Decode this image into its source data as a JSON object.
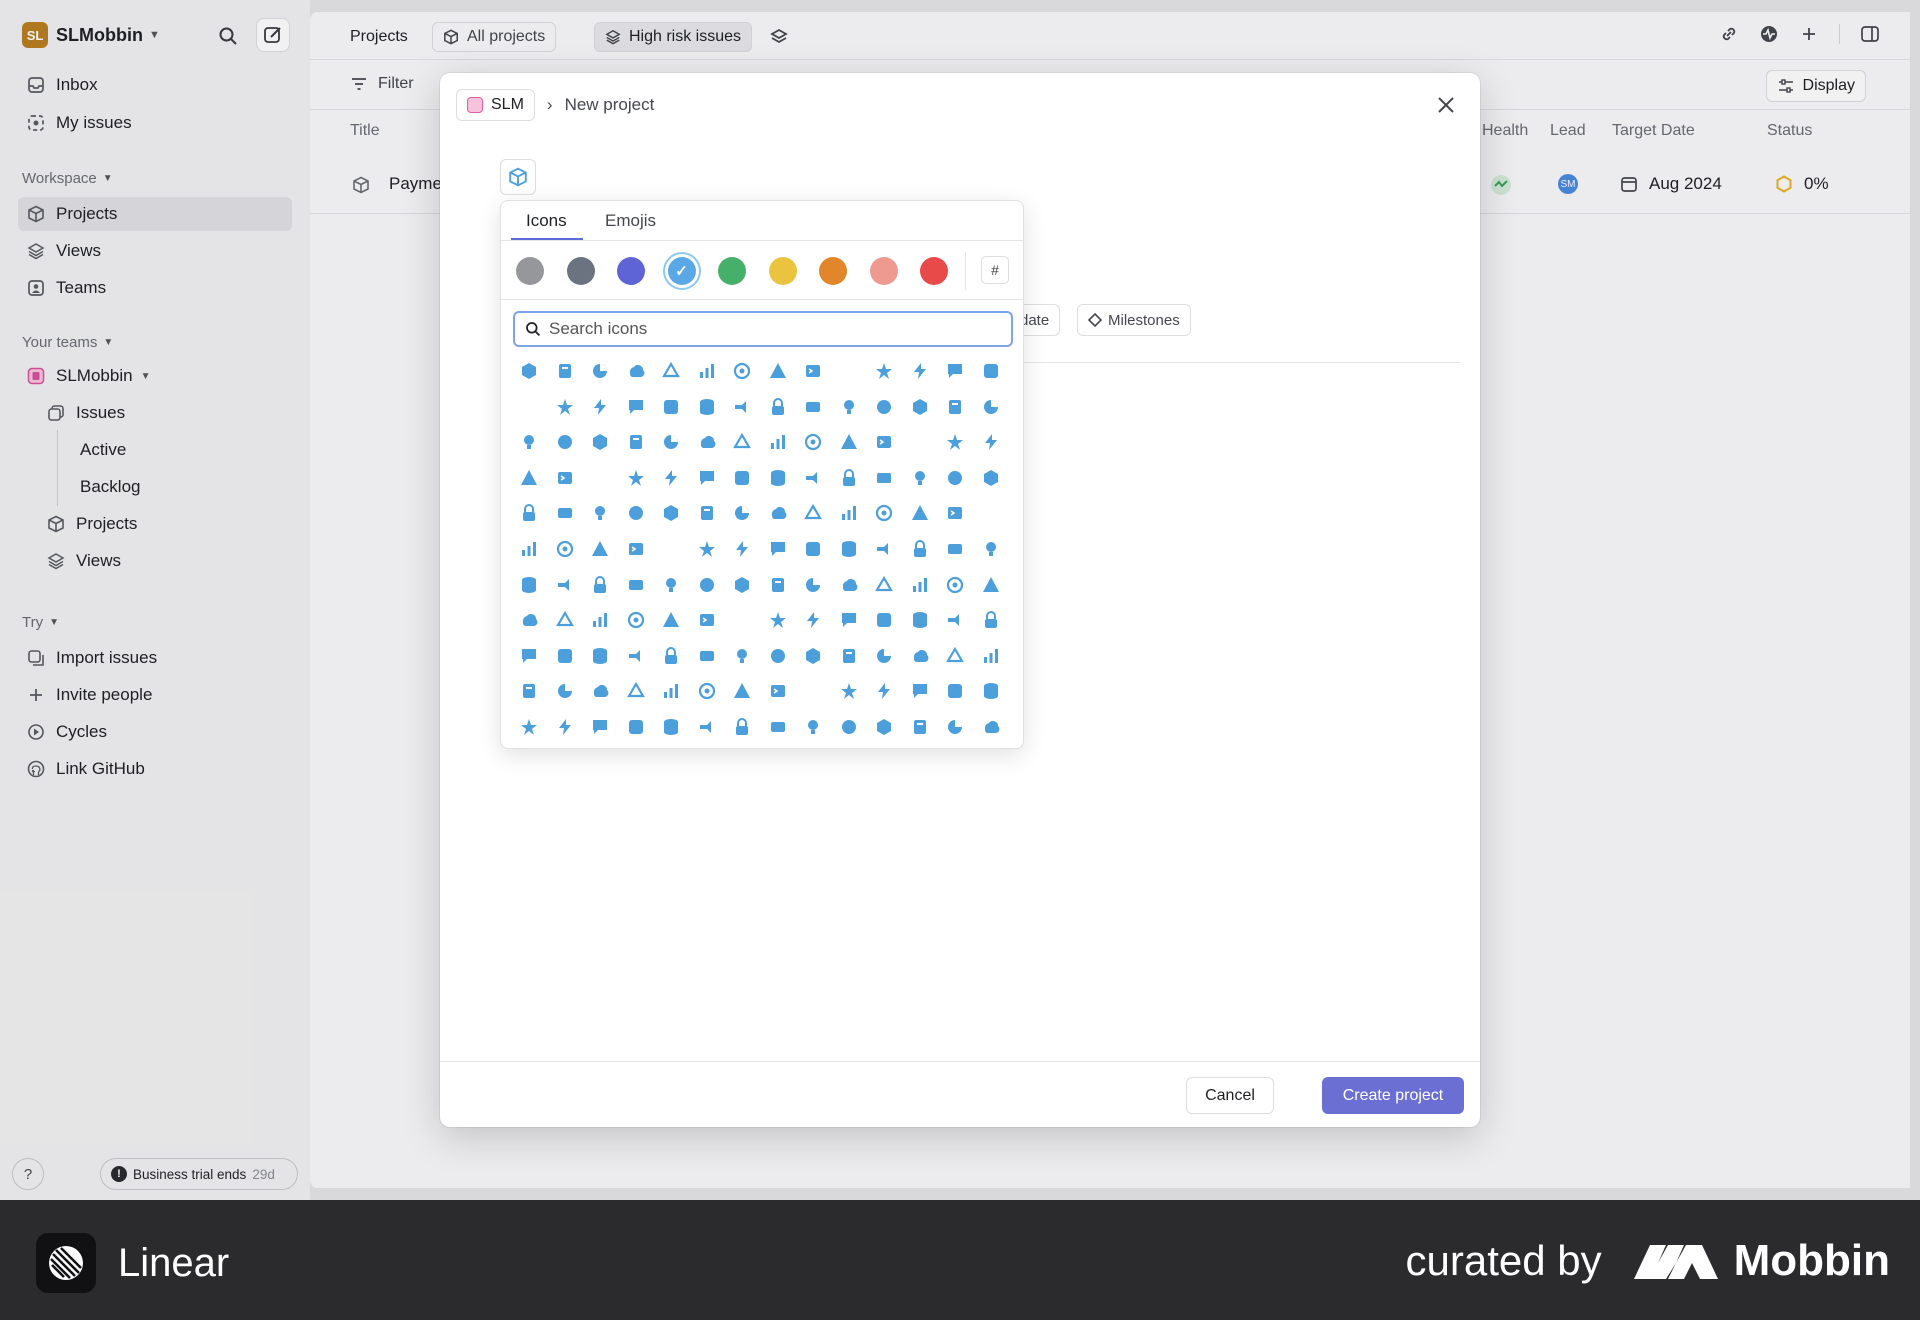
{
  "workspace": {
    "avatar": "SL",
    "name": "SLMobbin"
  },
  "sidebar": {
    "top_items": [
      {
        "label": "Inbox",
        "icon": "inbox-icon"
      },
      {
        "label": "My issues",
        "icon": "my-issues-icon"
      }
    ],
    "workspace_header": "Workspace",
    "workspace_items": [
      {
        "label": "Projects",
        "icon": "projects-icon",
        "active": true
      },
      {
        "label": "Views",
        "icon": "views-icon"
      },
      {
        "label": "Teams",
        "icon": "teams-icon"
      }
    ],
    "teams_header": "Your teams",
    "team": {
      "name": "SLMobbin"
    },
    "team_items": [
      {
        "label": "Issues"
      },
      {
        "label": "Active"
      },
      {
        "label": "Backlog"
      },
      {
        "label": "Projects"
      },
      {
        "label": "Views"
      }
    ],
    "try_header": "Try",
    "try_items": [
      {
        "label": "Import issues"
      },
      {
        "label": "Invite people"
      },
      {
        "label": "Cycles"
      },
      {
        "label": "Link GitHub"
      }
    ],
    "help": "?",
    "trial": {
      "label": "Business trial ends",
      "days": "29d"
    }
  },
  "topbar": {
    "title": "Projects",
    "tab_all": "All projects",
    "tab_risk": "High risk issues"
  },
  "filterbar": {
    "filter": "Filter",
    "display": "Display"
  },
  "table": {
    "columns": {
      "title": "Title",
      "health": "Health",
      "lead": "Lead",
      "target": "Target Date",
      "status": "Status"
    },
    "row": {
      "title": "Payme",
      "lead": "SM",
      "target": "Aug 2024",
      "status": "0%"
    }
  },
  "modal": {
    "team": "SLM",
    "separator": "›",
    "title": "New project",
    "prop_date": "date",
    "prop_milestones": "Milestones",
    "cancel": "Cancel",
    "create": "Create project"
  },
  "picker": {
    "tab_icons": "Icons",
    "tab_emojis": "Emojis",
    "hash": "#",
    "search_placeholder": "Search icons",
    "swatches": [
      "#96979b",
      "#6b7280",
      "#5e63d6",
      "#5aa8e6",
      "#46b06a",
      "#ebc43f",
      "#e1862b",
      "#ee9a90",
      "#e84a4a"
    ],
    "selected_swatch": 3,
    "icon_color": "#4d9fdc"
  },
  "footer": {
    "app": "Linear",
    "curated_by": "curated by",
    "mobbin": "Mobbin"
  }
}
